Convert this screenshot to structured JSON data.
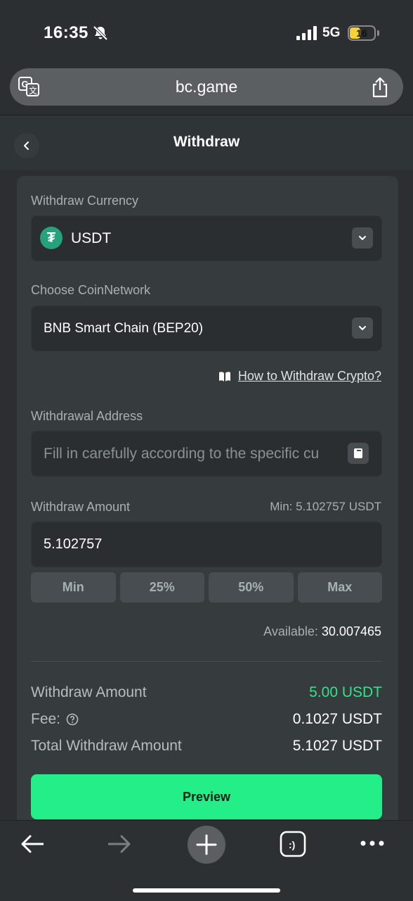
{
  "status_bar": {
    "time": "16:35",
    "network": "5G",
    "battery": "16"
  },
  "browser": {
    "url": "bc.game"
  },
  "header": {
    "title": "Withdraw"
  },
  "form": {
    "currency_label": "Withdraw Currency",
    "currency_value": "USDT",
    "currency_icon": "tether-icon",
    "network_label": "Choose CoinNetwork",
    "network_value": "BNB Smart Chain (BEP20)",
    "howto_link": "How to Withdraw Crypto?",
    "address_label": "Withdrawal Address",
    "address_placeholder": "Fill in carefully according to the specific cu",
    "amount_label": "Withdraw Amount",
    "min_text": "Min: 5.102757 USDT",
    "amount_value": "5.102757",
    "quick_buttons": [
      "Min",
      "25%",
      "50%",
      "Max"
    ],
    "available_label": "Available:",
    "available_value": "30.007465"
  },
  "summary": {
    "withdraw_label": "Withdraw Amount",
    "withdraw_value": "5.00 USDT",
    "fee_label": "Fee:",
    "fee_value": "0.1027 USDT",
    "total_label": "Total Withdraw Amount",
    "total_value": "5.1027 USDT"
  },
  "preview_button": "Preview",
  "colors": {
    "accent": "#23ee88",
    "green_text": "#38e08a",
    "card": "#363b3d",
    "background": "#2b2f31"
  }
}
